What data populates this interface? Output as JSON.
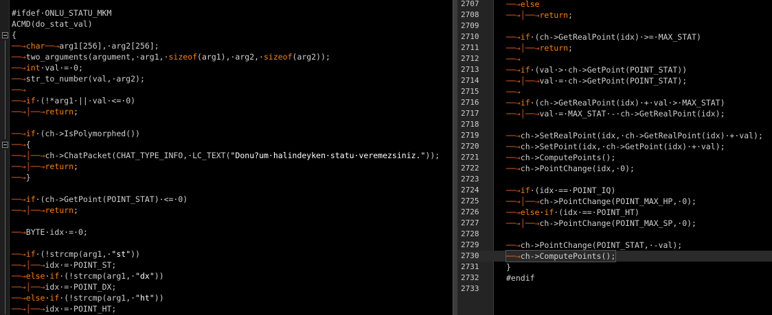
{
  "left": {
    "lines": [
      "#ifdef·ONLU_STATU_MKM",
      "ACMD(do_stat_val)",
      "{",
      "⟶char⟶arg1[256],·arg2[256];",
      "⟶two_arguments(argument,·arg1,·sizeof(arg1),·arg2,·sizeof(arg2));",
      "⟶int·val·=·0;",
      "⟶str_to_number(val,·arg2);",
      "⟶",
      "⟶if·(!*arg1·||·val·<=·0)",
      "⟶│⟶return;",
      "",
      "⟶if·(ch->IsPolymorphed())",
      "⟶{",
      "⟶│⟶ch->ChatPacket(CHAT_TYPE_INFO,·LC_TEXT(\"Donu?um·halindeyken·statu·veremezsiniz.\"));",
      "⟶│⟶return;",
      "⟶}",
      "",
      "⟶if·(ch->GetPoint(POINT_STAT)·<=·0)",
      "⟶│⟶return;",
      "",
      "⟶BYTE·idx·=·0;",
      "",
      "⟶if·(!strcmp(arg1,·\"st\"))",
      "⟶│⟶idx·=·POINT_ST;",
      "⟶else·if·(!strcmp(arg1,·\"dx\"))",
      "⟶│⟶idx·=·POINT_DX;",
      "⟶else·if·(!strcmp(arg1,·\"ht\"))",
      "⟶│⟶idx·=·POINT_HT;"
    ]
  },
  "right": {
    "line_numbers": [
      "2707",
      "2708",
      "2709",
      "2710",
      "2711",
      "2712",
      "2713",
      "2714",
      "2715",
      "2716",
      "2717",
      "2718",
      "2719",
      "2720",
      "2721",
      "2722",
      "2723",
      "2724",
      "2725",
      "2726",
      "2727",
      "2728",
      "2729",
      "2730",
      "2731",
      "2732",
      "2733"
    ],
    "lines": [
      "⟶else",
      "⟶│⟶return;",
      "",
      "⟶if·(ch->GetRealPoint(idx)·>=·MAX_STAT)",
      "⟶│⟶return;",
      "⟶",
      "⟶if·(val·>·ch->GetPoint(POINT_STAT))",
      "⟶│⟶val·=·ch->GetPoint(POINT_STAT);",
      "⟶",
      "⟶if·(ch->GetRealPoint(idx)·+·val·>·MAX_STAT)",
      "⟶│⟶val·=·MAX_STAT·-·ch->GetRealPoint(idx);",
      "",
      "⟶ch->SetRealPoint(idx,·ch->GetRealPoint(idx)·+·val);",
      "⟶ch->SetPoint(idx,·ch->GetPoint(idx)·+·val);",
      "⟶ch->ComputePoints();",
      "⟶ch->PointChange(idx,·0);",
      "",
      "⟶if·(idx·==·POINT_IQ)",
      "⟶│⟶ch->PointChange(POINT_MAX_HP,·0);",
      "⟶else·if·(idx·==·POINT_HT)",
      "⟶│⟶ch->PointChange(POINT_MAX_SP,·0);",
      "",
      "⟶ch->PointChange(POINT_STAT,·-val);",
      "⟶ch->ComputePoints();",
      "}",
      "#endif",
      ""
    ],
    "current_line": "2730"
  },
  "colors": {
    "keyword": "#ff8000",
    "whitespace_marker": "#e06020",
    "background": "#000000"
  }
}
